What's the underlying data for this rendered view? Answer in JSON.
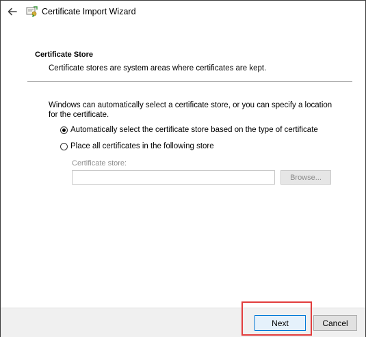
{
  "window": {
    "title": "Certificate Import Wizard"
  },
  "section": {
    "title": "Certificate Store",
    "description": "Certificate stores are system areas where certificates are kept."
  },
  "body": {
    "intro": "Windows can automatically select a certificate store, or you can specify a location for the certificate.",
    "options": [
      {
        "label": "Automatically select the certificate store based on the type of certificate",
        "selected": true
      },
      {
        "label": "Place all certificates in the following store",
        "selected": false
      }
    ],
    "store_label": "Certificate store:",
    "store_value": "",
    "browse_label": "Browse..."
  },
  "footer": {
    "next_label": "Next",
    "cancel_label": "Cancel"
  },
  "colors": {
    "highlight": "#e23c3c",
    "accent": "#0078d7"
  },
  "icons": {
    "back": "back-arrow-icon",
    "app": "certificate-icon"
  }
}
